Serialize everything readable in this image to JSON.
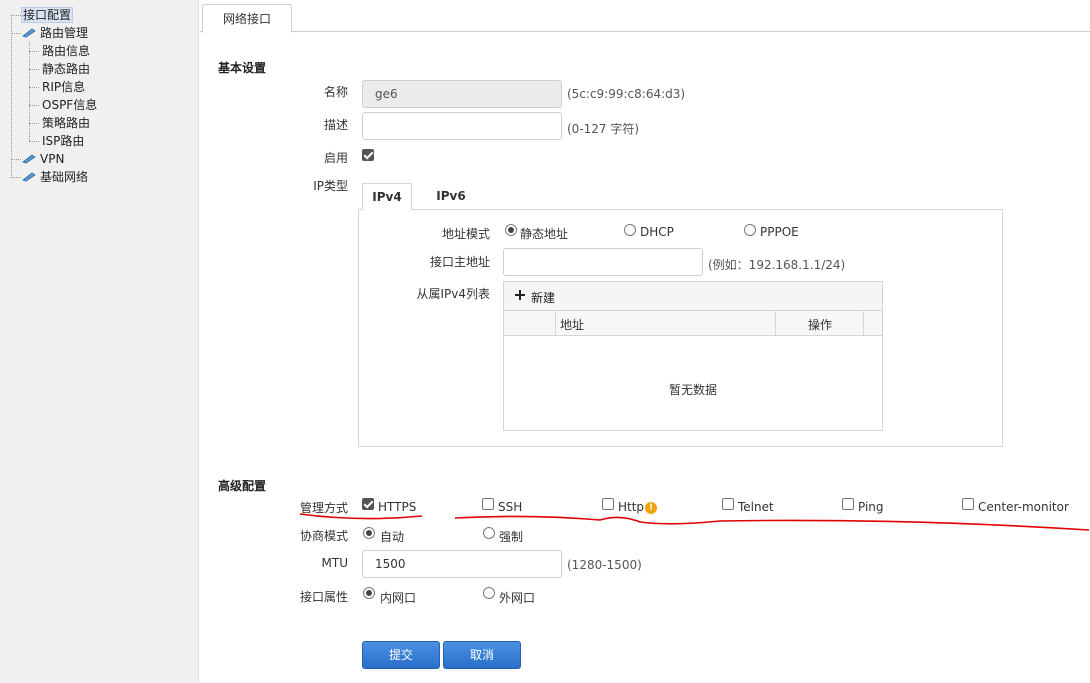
{
  "sidebar": {
    "root": "接口配置",
    "items": [
      {
        "label": "路由管理",
        "children": [
          "路由信息",
          "静态路由",
          "RIP信息",
          "OSPF信息",
          "策略路由",
          "ISP路由"
        ]
      },
      {
        "label": "VPN"
      },
      {
        "label": "基础网络"
      }
    ]
  },
  "tab": "网络接口",
  "basic": {
    "title": "基本设置",
    "name_label": "名称",
    "name_value": "ge6",
    "name_hint": "(5c:c9:99:c8:64:d3)",
    "desc_label": "描述",
    "desc_value": "",
    "desc_hint": "(0-127 字符)",
    "enable_label": "启用",
    "iptype_label": "IP类型",
    "ip_tabs": [
      "IPv4",
      "IPv6"
    ]
  },
  "ipv4": {
    "mode_label": "地址模式",
    "modes": [
      "静态地址",
      "DHCP",
      "PPPOE"
    ],
    "main_addr_label": "接口主地址",
    "main_addr_value": "",
    "main_addr_hint": "(例如：192.168.1.1/24)",
    "sub_list_label": "从属IPv4列表",
    "new_label": "新建",
    "col_address": "地址",
    "col_action": "操作",
    "empty_text": "暂无数据"
  },
  "advanced": {
    "title": "高级配置",
    "mgmt_label": "管理方式",
    "mgmt_options": [
      "HTTPS",
      "SSH",
      "Http",
      "Telnet",
      "Ping",
      "Center-monitor"
    ],
    "mgmt_checked": [
      true,
      false,
      false,
      false,
      false,
      false
    ],
    "nego_label": "协商模式",
    "nego_options": [
      "自动",
      "强制"
    ],
    "mtu_label": "MTU",
    "mtu_value": "1500",
    "mtu_hint": "(1280-1500)",
    "attr_label": "接口属性",
    "attr_options": [
      "内网口",
      "外网口"
    ]
  },
  "buttons": {
    "submit": "提交",
    "cancel": "取消"
  },
  "colors": {
    "accent": "#2a6fc9",
    "annotation": "#e00000",
    "warn": "#f0a30a"
  }
}
